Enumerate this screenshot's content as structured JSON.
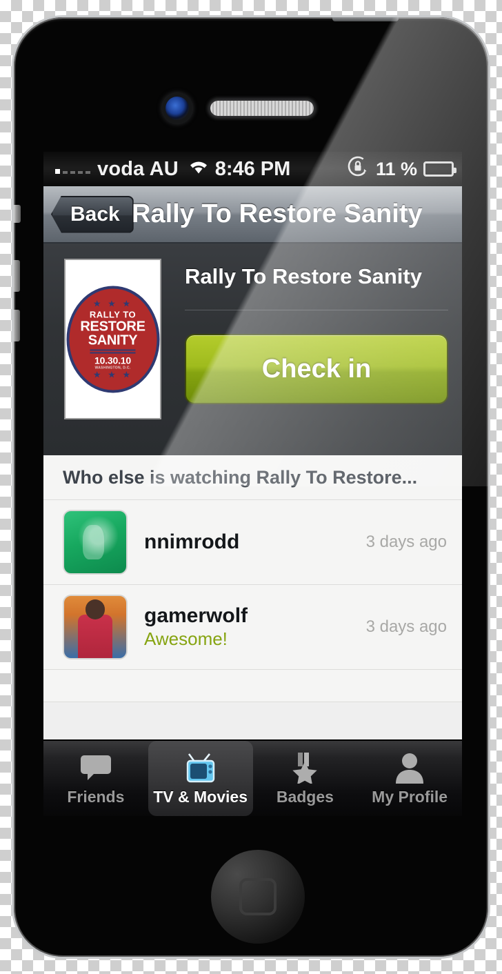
{
  "status_bar": {
    "carrier": "voda AU",
    "signal_filled": 1,
    "signal_total": 5,
    "wifi_icon": "wifi-icon",
    "time": "8:46 PM",
    "rotation_lock_icon": "rotation-lock-icon",
    "battery_percent": "11 %",
    "battery_level": 11,
    "battery_color": "#e8453c"
  },
  "nav_bar": {
    "back_label": "Back",
    "title": "Rally To Restore Sanity"
  },
  "detail": {
    "poster": {
      "alt": "rally-to-restore-sanity-poster",
      "line1": "RALLY TO",
      "line2": "RESTORE",
      "line3": "SANITY",
      "date": "10.30.10",
      "city": "WASHINGTON, D.C.",
      "stars": "★ ★ ★",
      "circle_color": "#b02b2b",
      "border_color": "#2f3a72"
    },
    "title": "Rally To Restore Sanity",
    "checkin_label": "Check in",
    "checkin_color": "#9fbb1d"
  },
  "list": {
    "header": "Who else is watching Rally To Restore...",
    "rows": [
      {
        "name": "nnimrodd",
        "comment": "",
        "time": "3 days ago",
        "avatar": "avatar-nnimrodd"
      },
      {
        "name": "gamerwolf",
        "comment": "Awesome!",
        "time": "3 days ago",
        "avatar": "avatar-gamerwolf"
      }
    ],
    "comment_color": "#86a411"
  },
  "tab_bar": {
    "tabs": [
      {
        "label": "Friends",
        "icon": "speech-bubble-icon",
        "active": false
      },
      {
        "label": "TV & Movies",
        "icon": "television-icon",
        "active": true
      },
      {
        "label": "Badges",
        "icon": "medal-star-icon",
        "active": false
      },
      {
        "label": "My Profile",
        "icon": "person-icon",
        "active": false
      }
    ]
  }
}
